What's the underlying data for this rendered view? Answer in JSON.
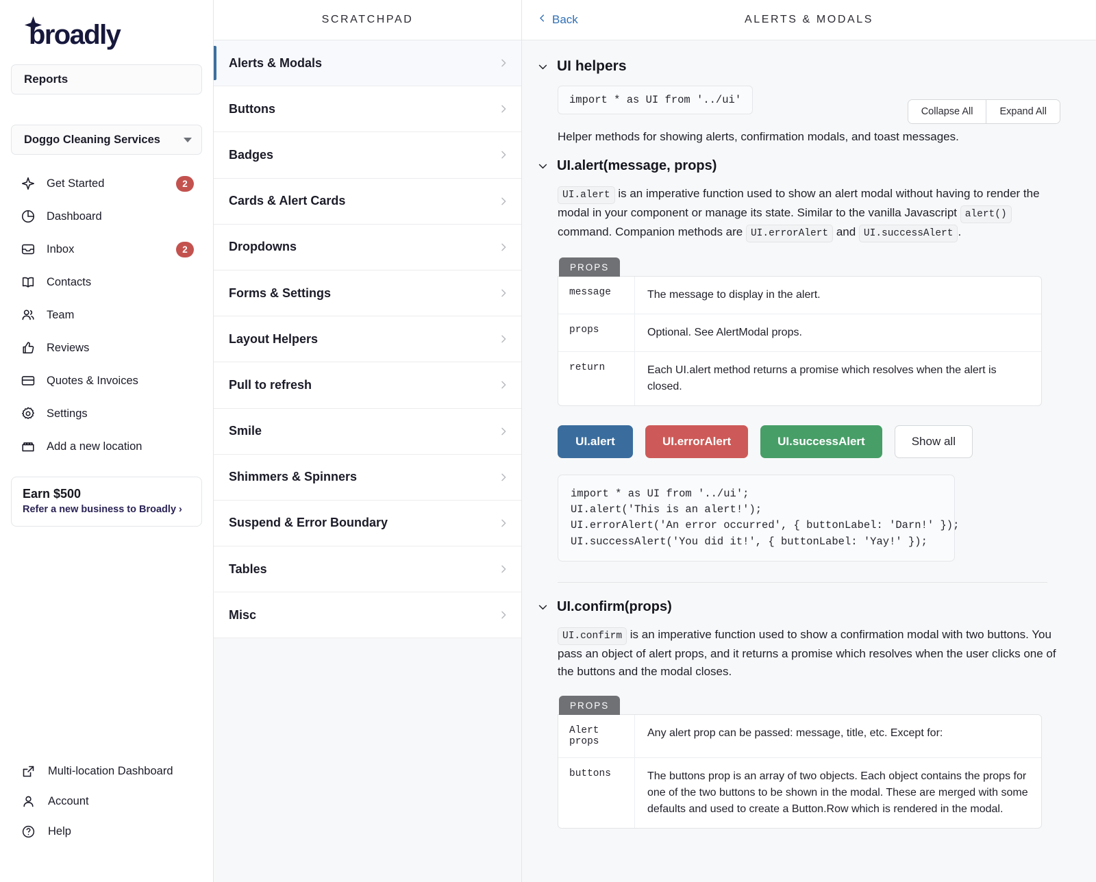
{
  "sidebar": {
    "logo_text": "broadly",
    "reports_label": "Reports",
    "business": {
      "name": "Doggo Cleaning Services",
      "caret_icon": "chevron-down-icon"
    },
    "nav_items": [
      {
        "label": "Get Started",
        "icon": "sparkle-icon",
        "badge": "2"
      },
      {
        "label": "Dashboard",
        "icon": "pie-chart-icon",
        "badge": ""
      },
      {
        "label": "Inbox",
        "icon": "inbox-icon",
        "badge": "2"
      },
      {
        "label": "Contacts",
        "icon": "book-icon",
        "badge": ""
      },
      {
        "label": "Team",
        "icon": "users-icon",
        "badge": ""
      },
      {
        "label": "Reviews",
        "icon": "thumbs-up-icon",
        "badge": ""
      },
      {
        "label": "Quotes & Invoices",
        "icon": "credit-card-icon",
        "badge": ""
      },
      {
        "label": "Settings",
        "icon": "gear-icon",
        "badge": ""
      },
      {
        "label": "Add a new location",
        "icon": "storefront-icon",
        "badge": ""
      }
    ],
    "promo": {
      "title": "Earn $500",
      "subtitle": "Refer a new business to Broadly ›"
    },
    "footer_items": [
      {
        "label": "Multi-location Dashboard",
        "icon": "external-link-icon"
      },
      {
        "label": "Account",
        "icon": "user-icon"
      },
      {
        "label": "Help",
        "icon": "question-circle-icon"
      }
    ]
  },
  "scratchpad": {
    "header": "SCRATCHPAD",
    "items": [
      {
        "label": "Alerts & Modals",
        "active": true
      },
      {
        "label": "Buttons",
        "active": false
      },
      {
        "label": "Badges",
        "active": false
      },
      {
        "label": "Cards & Alert Cards",
        "active": false
      },
      {
        "label": "Dropdowns",
        "active": false
      },
      {
        "label": "Forms & Settings",
        "active": false
      },
      {
        "label": "Layout Helpers",
        "active": false
      },
      {
        "label": "Pull to refresh",
        "active": false
      },
      {
        "label": "Smile",
        "active": false
      },
      {
        "label": "Shimmers & Spinners",
        "active": false
      },
      {
        "label": "Suspend & Error Boundary",
        "active": false
      },
      {
        "label": "Tables",
        "active": false
      },
      {
        "label": "Misc",
        "active": false
      }
    ]
  },
  "main": {
    "back_label": "Back",
    "title": "ALERTS & MODALS",
    "collapse_all_label": "Collapse All",
    "expand_all_label": "Expand All",
    "sections": {
      "ui_helpers": {
        "title": "UI helpers",
        "import_code": "import * as UI from '../ui'",
        "description": "Helper methods for showing alerts, confirmation modals, and toast messages."
      },
      "ui_alert": {
        "title": "UI.alert(message, props)",
        "desc_chip1": "UI.alert",
        "desc_part1": " is an imperative function used to show an alert modal without having to render the modal in your component or manage its state. Similar to the vanilla Javascript ",
        "desc_chip2": "alert()",
        "desc_part2": " command. Companion methods are ",
        "desc_chip3": "UI.errorAlert",
        "desc_part3": " and ",
        "desc_chip4": "UI.successAlert",
        "desc_part4": ".",
        "props_tag": "PROPS",
        "props_rows": [
          {
            "key": "message",
            "value": "The message to display in the alert."
          },
          {
            "key": "props",
            "value": "Optional. See AlertModal props."
          },
          {
            "key": "return",
            "value": "Each UI.alert method returns a promise which resolves when the alert is closed."
          }
        ],
        "buttons": [
          {
            "label": "UI.alert",
            "style": "blue"
          },
          {
            "label": "UI.errorAlert",
            "style": "red"
          },
          {
            "label": "UI.successAlert",
            "style": "green"
          },
          {
            "label": "Show all",
            "style": "ghost"
          }
        ],
        "code_sample": "import * as UI from '../ui';\nUI.alert('This is an alert!');\nUI.errorAlert('An error occurred', { buttonLabel: 'Darn!' });\nUI.successAlert('You did it!', { buttonLabel: 'Yay!' });"
      },
      "ui_confirm": {
        "title": "UI.confirm(props)",
        "desc_chip1": "UI.confirm",
        "desc_part1": " is an imperative function used to show a confirmation modal with two buttons. You pass an object of alert props, and it returns a promise which resolves when the user clicks one of the buttons and the modal closes.",
        "props_tag": "PROPS",
        "props_rows": [
          {
            "key": "Alert props",
            "value": "Any alert prop can be passed: message, title, etc. Except for:"
          },
          {
            "key": "buttons",
            "value": "The buttons prop is an array of two objects. Each object contains the props for one of the two buttons to be shown in the modal. These are merged with some defaults and used to create a Button.Row which is rendered in the modal."
          }
        ]
      }
    }
  },
  "colors": {
    "accent_blue": "#3a6d9d",
    "link_blue": "#2f6fb5",
    "danger_red": "#cd5a58",
    "success_green": "#479e67",
    "badge_red": "#c3524f",
    "logo_navy": "#17183c",
    "panel_bg": "#f7f8f9"
  }
}
